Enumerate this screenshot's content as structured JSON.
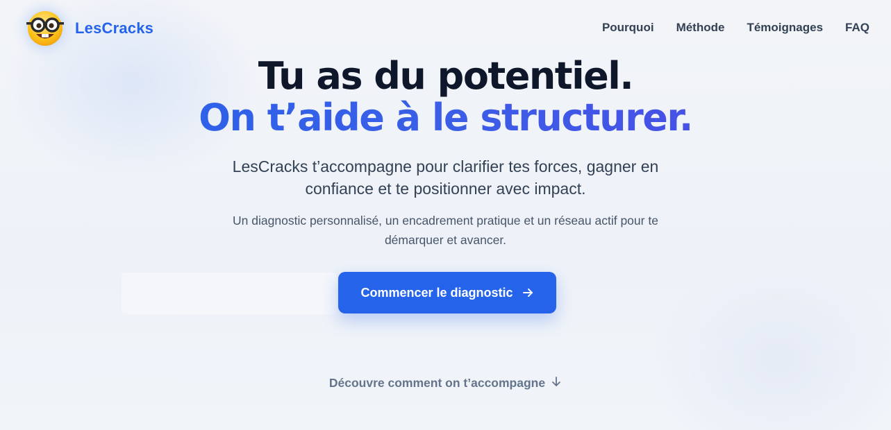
{
  "header": {
    "brand": "LesCracks",
    "logo_icon": "nerd-face-emoji",
    "nav": [
      {
        "label": "Pourquoi"
      },
      {
        "label": "Méthode"
      },
      {
        "label": "Témoignages"
      },
      {
        "label": "FAQ"
      }
    ]
  },
  "hero": {
    "headline_line1": "Tu as du potentiel.",
    "headline_line2": "On t’aide à le structurer.",
    "lead": "LesCracks t’accompagne pour clarifier tes forces, gagner en confiance et te positionner avec impact.",
    "subtext": "Un diagnostic personnalisé, un encadrement pratique et un réseau actif pour te démarquer et avancer.",
    "cta_label": "Commencer le diagnostic",
    "cta_icon": "arrow-right-icon",
    "discover_label": "Découvre comment on t’accompagne",
    "discover_icon": "arrow-down-icon"
  },
  "colors": {
    "brand": "#2563eb",
    "gradient_end": "#4f46e5",
    "text_dark": "#0f172a",
    "background": "#f1f4f9"
  }
}
